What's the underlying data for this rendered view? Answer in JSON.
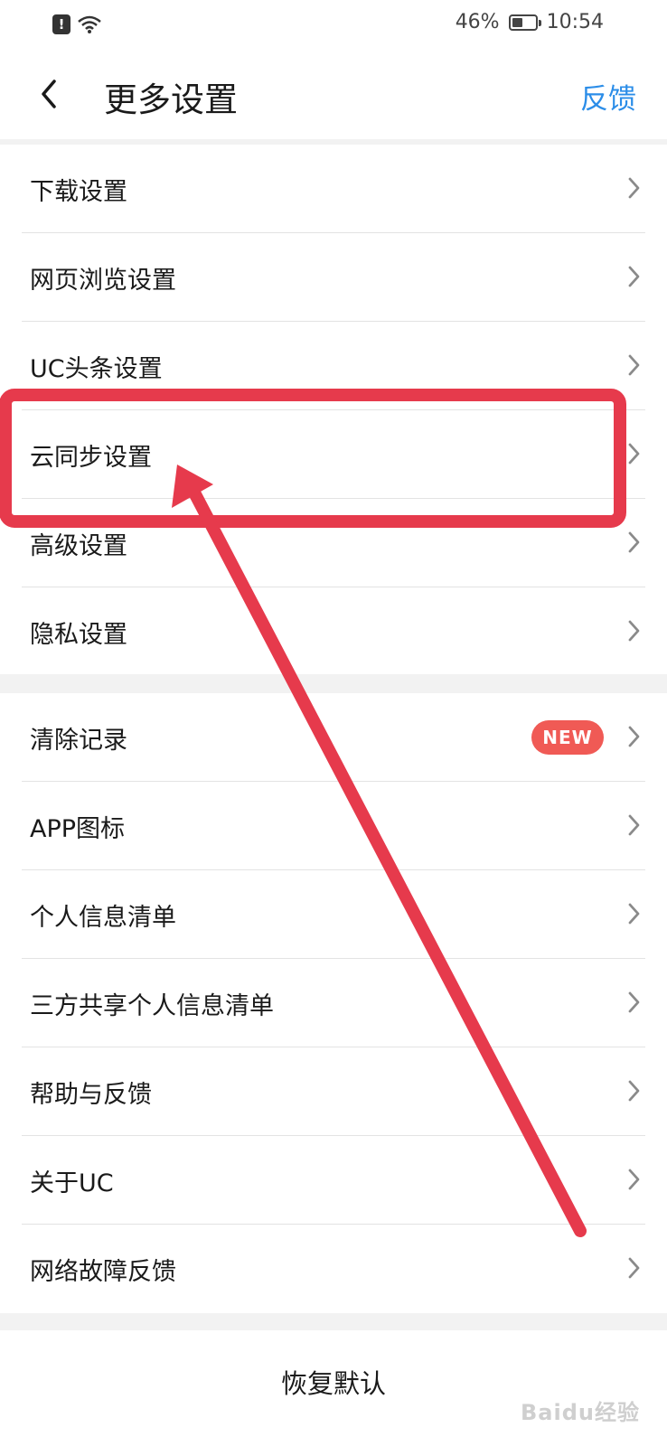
{
  "status_bar": {
    "battery": "46%",
    "battery_level": 0.46,
    "time": "10:54"
  },
  "header": {
    "title": "更多设置",
    "feedback": "反馈"
  },
  "group1": [
    {
      "label": "下载设置"
    },
    {
      "label": "网页浏览设置"
    },
    {
      "label": "UC头条设置"
    },
    {
      "label": "云同步设置"
    },
    {
      "label": "高级设置"
    },
    {
      "label": "隐私设置"
    }
  ],
  "group2": [
    {
      "label": "清除记录",
      "badge": "NEW"
    },
    {
      "label": "APP图标"
    },
    {
      "label": "个人信息清单"
    },
    {
      "label": "三方共享个人信息清单"
    },
    {
      "label": "帮助与反馈"
    },
    {
      "label": "关于UC"
    },
    {
      "label": "网络故障反馈"
    }
  ],
  "footer": {
    "restore": "恢复默认"
  },
  "watermark": "Baidu经验",
  "annotation_color": "#e63a4c",
  "accent_color": "#2b8de8"
}
